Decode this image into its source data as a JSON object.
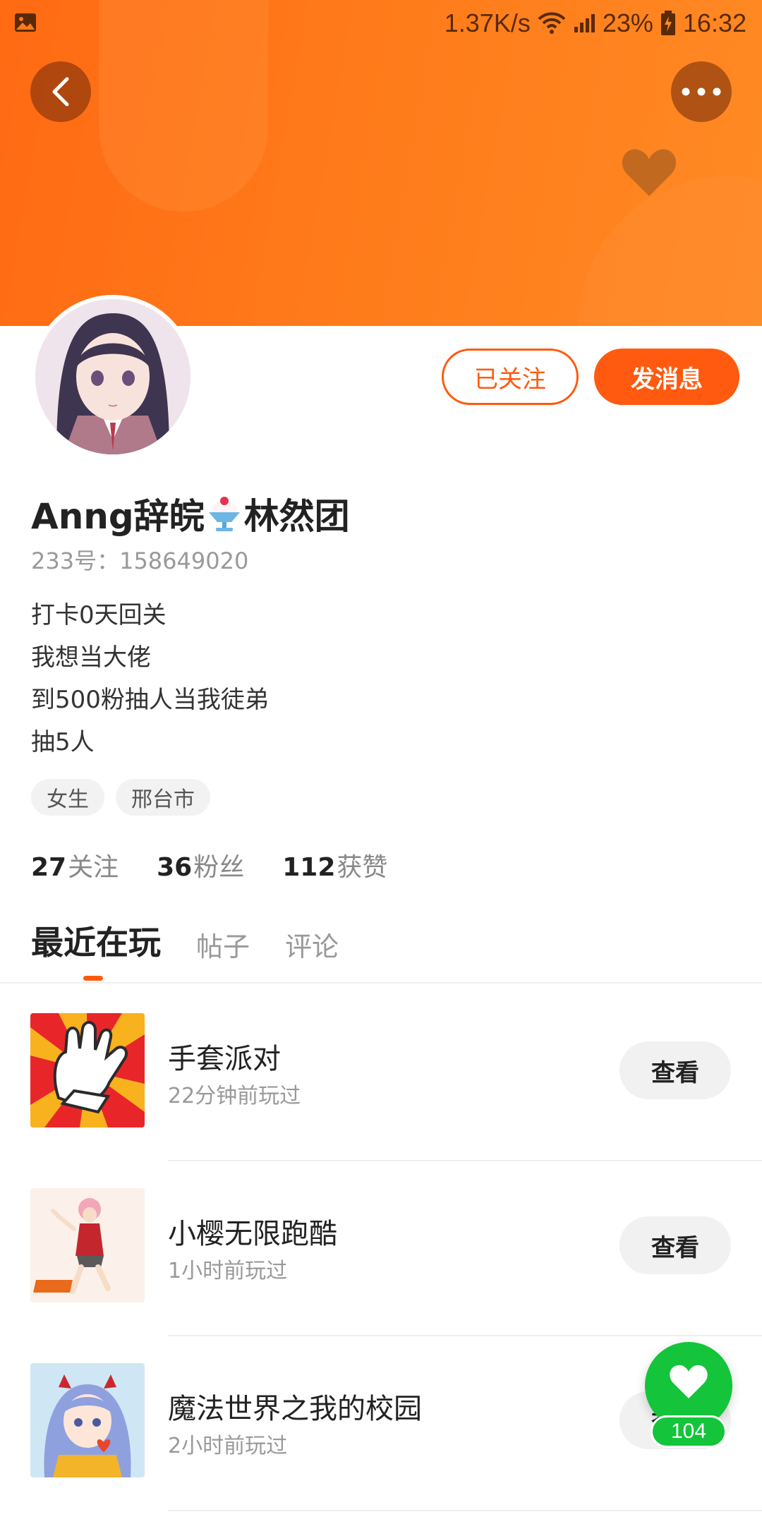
{
  "status_bar": {
    "network_speed": "1.37K/s",
    "battery": "23%",
    "time": "16:32"
  },
  "header": {
    "back_icon": "chevron-left-icon",
    "more_icon": "more-dots-icon",
    "decor_icon": "heart-icon"
  },
  "profile": {
    "follow_button": "已关注",
    "message_button": "发消息",
    "username_prefix": "Anng辞皖",
    "username_suffix": "林然团",
    "username_emoji": "shaved-ice-emoji-icon",
    "account_id": "233号：158649020",
    "bio": [
      "打卡0天回关",
      "我想当大佬",
      "到500粉抽人当我徒弟",
      "抽5人"
    ],
    "tags": [
      "女生",
      "邢台市"
    ],
    "stats": [
      {
        "count": "27",
        "label": "关注"
      },
      {
        "count": "36",
        "label": "粉丝"
      },
      {
        "count": "112",
        "label": "获赞"
      }
    ]
  },
  "tabs": [
    "最近在玩",
    "帖子",
    "评论"
  ],
  "active_tab": "最近在玩",
  "games": [
    {
      "title": "手套派对",
      "played": "22分钟前玩过",
      "action": "查看"
    },
    {
      "title": "小樱无限跑酷",
      "played": "1小时前玩过",
      "action": "查看"
    },
    {
      "title": "魔法世界之我的校园",
      "played": "2小时前玩过",
      "action": "查看"
    }
  ],
  "like_fab": {
    "count": "104",
    "icon": "heart-icon"
  },
  "colors": {
    "accent": "#ff5a0f",
    "header": "#ff7a1a",
    "like_green": "#14c43a"
  }
}
